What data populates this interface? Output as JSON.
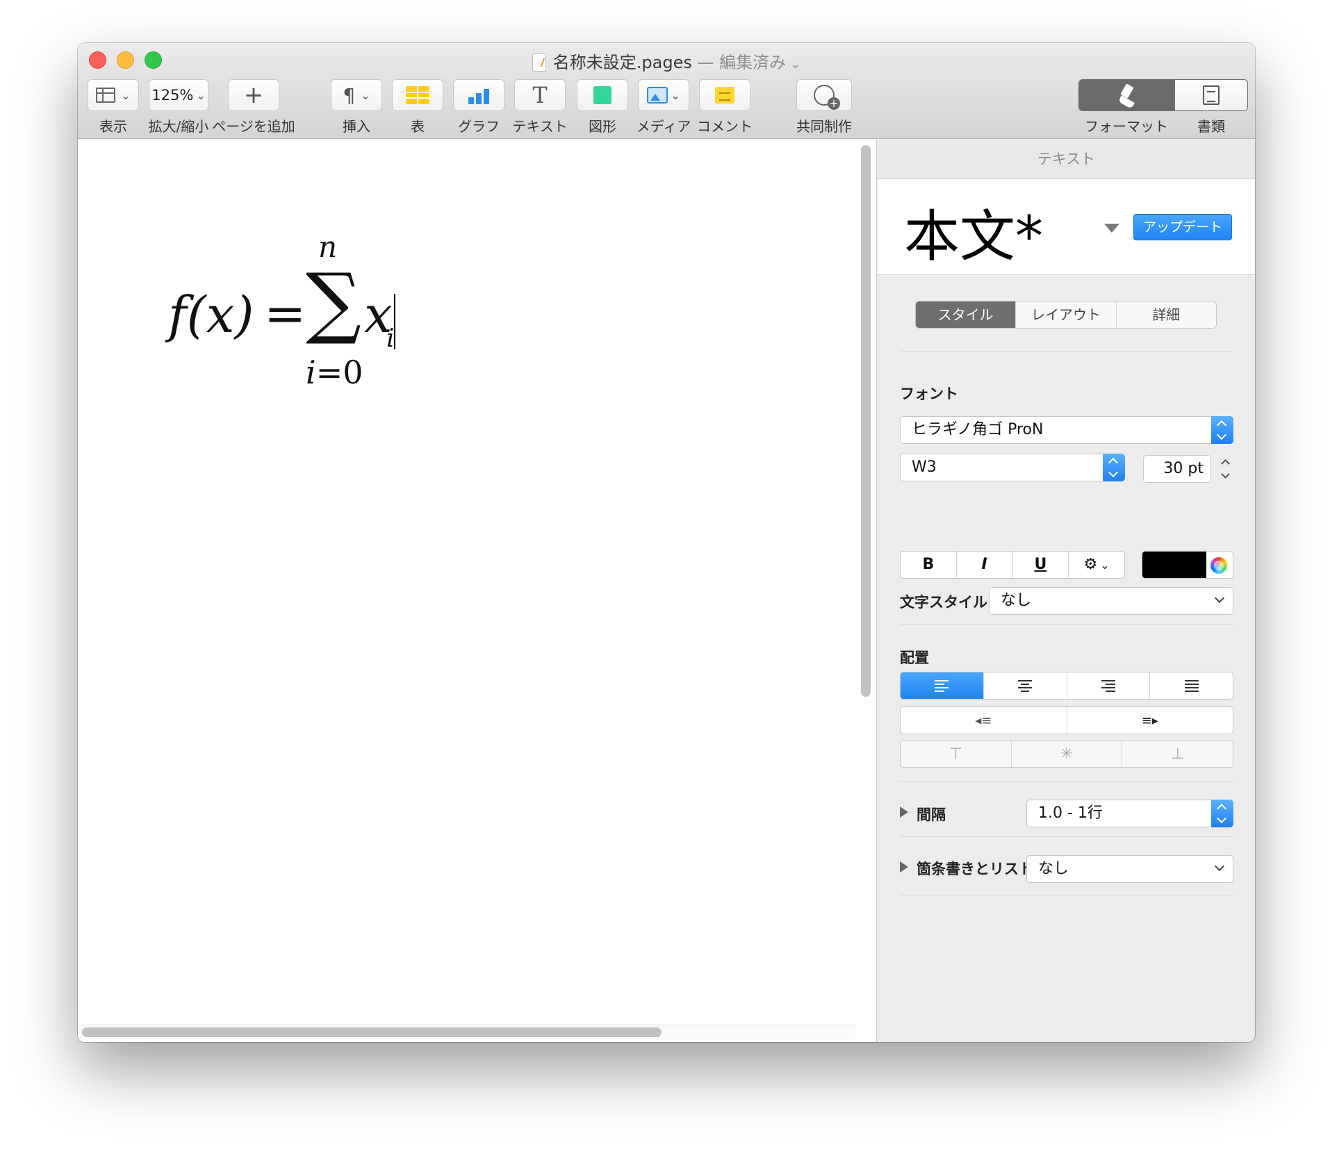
{
  "window": {
    "title": "名称未設定.pages",
    "separator": "—",
    "status": "編集済み"
  },
  "toolbar": {
    "view_label": "表示",
    "zoom_value": "125%",
    "zoom_label": "拡大/縮小",
    "add_page_label": "ページを追加",
    "insert_label": "挿入",
    "table_label": "表",
    "chart_label": "グラフ",
    "text_label": "テキスト",
    "shape_label": "図形",
    "media_label": "メディア",
    "comment_label": "コメント",
    "collaborate_label": "共同制作",
    "format_label": "フォーマット",
    "document_label": "書類"
  },
  "document": {
    "formula": {
      "lhs": "f(x)",
      "equals": "=",
      "sigma": "∑",
      "upper": "n",
      "lower_var": "i",
      "lower_eq": "=0",
      "term": "x",
      "subscript": "i"
    }
  },
  "inspector": {
    "header": "テキスト",
    "paragraph_style": "本文*",
    "update_button": "アップデート",
    "tabs": [
      "スタイル",
      "レイアウト",
      "詳細"
    ],
    "font_section": "フォント",
    "font_family": "ヒラギノ角ゴ ProN",
    "font_weight": "W3",
    "font_size": "30 pt",
    "bold": "B",
    "italic": "I",
    "underline": "U",
    "gear": "⚙",
    "text_color": "#000000",
    "char_style_label": "文字スタイル",
    "char_style_value": "なし",
    "alignment_section": "配置",
    "spacing_label": "間隔",
    "spacing_value": "1.0 - 1行",
    "bullets_label": "箇条書きとリスト",
    "bullets_value": "なし"
  },
  "colors": {
    "accent": "#1f85f1",
    "close": "#fc605c",
    "minimize": "#fdbc40",
    "maximize": "#34c84a"
  }
}
